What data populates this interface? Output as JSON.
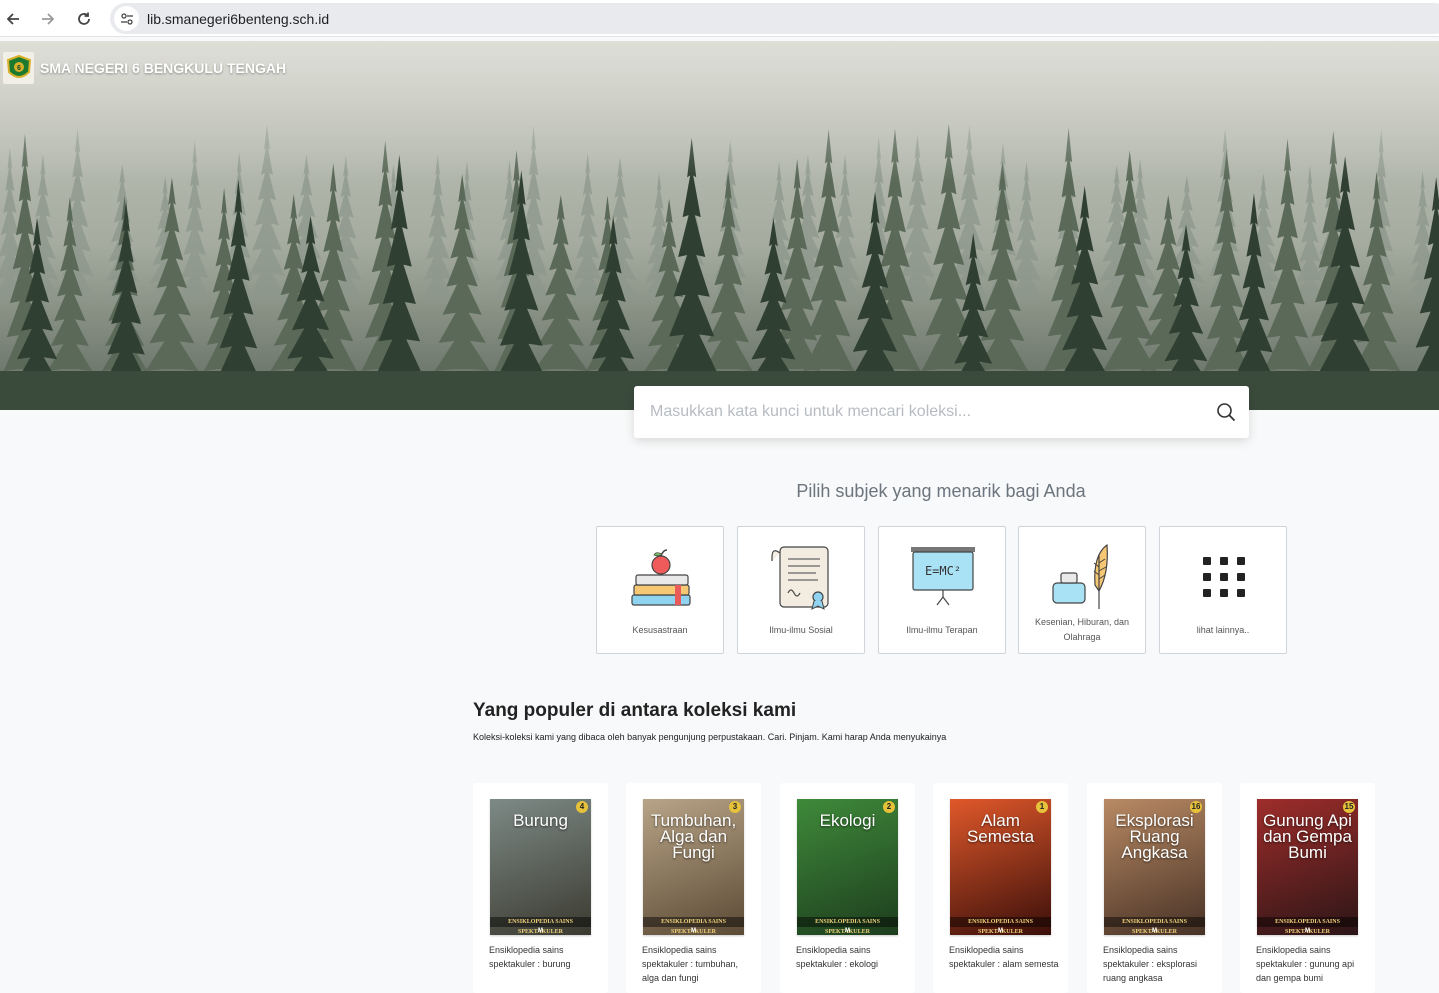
{
  "browser": {
    "url": "lib.smanegeri6benteng.sch.id",
    "icons": [
      "back-arrow-icon",
      "forward-arrow-icon",
      "reload-icon",
      "site-info-icon"
    ]
  },
  "brand": {
    "name": "SMA NEGERI 6 BENGKULU TENGAH"
  },
  "search": {
    "placeholder": "Masukkan kata kunci untuk mencari koleksi..."
  },
  "subjects": {
    "heading": "Pilih subjek yang menarik bagi Anda",
    "items": [
      {
        "label": "Kesusastraan",
        "icon": "books-apple-icon"
      },
      {
        "label": "Ilmu-ilmu Sosial",
        "icon": "scroll-certificate-icon"
      },
      {
        "label": "Ilmu-ilmu Terapan",
        "icon": "blackboard-formula-icon"
      },
      {
        "label": "Kesenian, Hiburan, dan Olahraga",
        "icon": "ink-feather-icon"
      },
      {
        "label": "lihat lainnya..",
        "icon": "grid-dots-icon"
      }
    ],
    "formula": "E=MC²"
  },
  "popular": {
    "title": "Yang populer di antara koleksi kami",
    "subtitle": "Koleksi-koleksi kami yang dibaca oleh banyak pengunjung perpustakaan. Cari. Pinjam. Kami harap Anda menyukainya",
    "series_label": "ENSIKLOPEDIA SAINS SPEKTAKULER",
    "publisher_mark": "M",
    "books": [
      {
        "cover_title": "Burung",
        "number": "4",
        "caption": "Ensiklopedia sains spektakuler : burung",
        "colors": [
          "#7d8a86",
          "#3b3a30"
        ]
      },
      {
        "cover_title": "Tumbuhan, Alga dan Fungi",
        "number": "3",
        "caption": "Ensiklopedia sains spektakuler : tumbuhan, alga dan fungi",
        "colors": [
          "#b8a487",
          "#5b4a35"
        ]
      },
      {
        "cover_title": "Ekologi",
        "number": "2",
        "caption": "Ensiklopedia sains spektakuler : ekologi",
        "colors": [
          "#3f8a3a",
          "#1d3d1e"
        ]
      },
      {
        "cover_title": "Alam Semesta",
        "number": "1",
        "caption": "Ensiklopedia sains spektakuler : alam semesta",
        "colors": [
          "#e0582a",
          "#3a0f0a"
        ]
      },
      {
        "cover_title": "Eksplorasi Ruang Angkasa",
        "number": "16",
        "caption": "Ensiklopedia sains spektakuler : eksplorasi ruang angkasa",
        "colors": [
          "#b98a64",
          "#473226"
        ]
      },
      {
        "cover_title": "Gunung Api dan Gempa Bumi",
        "number": "15",
        "caption": "Ensiklopedia sains spektakuler : gunung api dan gempa bumi",
        "colors": [
          "#9e2d2a",
          "#2b1517"
        ]
      }
    ]
  }
}
